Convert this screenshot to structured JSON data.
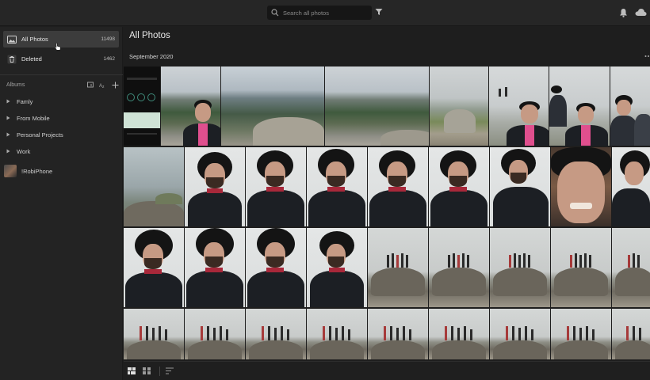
{
  "search": {
    "placeholder": "Search all photos"
  },
  "sidebar": {
    "items": [
      {
        "label": "All Photos",
        "count": "11498",
        "icon": "photos-icon",
        "active": true
      },
      {
        "label": "Deleted",
        "count": "1462",
        "icon": "trash-icon",
        "active": false
      }
    ],
    "albums_label": "Albums",
    "albums": [
      "Famly",
      "From Mobile",
      "Personal Projects",
      "Work"
    ],
    "device": "!RobiPhone"
  },
  "main": {
    "title": "All Photos",
    "section": "September 2020"
  },
  "icons": {
    "search": "search-icon",
    "filter": "filter-icon",
    "bell": "bell-icon",
    "cloud": "cloud-icon",
    "add_album": "add-album-icon",
    "sort_az": "sort-az-icon",
    "add": "plus-icon"
  },
  "colors": {
    "background": "#1e1e1e",
    "sidebar": "#232323",
    "active_item": "#3c3c3c",
    "topbar": "#262626"
  }
}
